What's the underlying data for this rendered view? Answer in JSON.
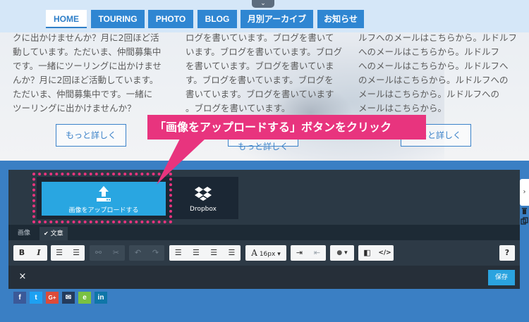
{
  "nav": {
    "toggle_glyph": "⌄",
    "items": [
      "HOME",
      "TOURING",
      "PHOTO",
      "BLOG",
      "月別アーカイブ",
      "お知らせ"
    ]
  },
  "columns": [
    {
      "lines": [
        "クに出かけませんか？月に2回ほど活",
        "動しています。ただいま、仲間募集中",
        "です。一緒にツーリングに出かけませ",
        "んか？月に2回ほど活動しています。",
        "ただいま、仲間募集中です。一緒に",
        "ツーリングに出かけませんか？"
      ],
      "more": "もっと詳しく"
    },
    {
      "lines": [
        "ログを書いています。ブログを書いて",
        "います。ブログを書いています。ブログ",
        "を書いています。ブログを書いていま",
        "す。ブログを書いています。ブログを",
        "書いています。ブログを書いています",
        "。ブログを書いています。"
      ],
      "more": "もっと詳しく"
    },
    {
      "lines": [
        "ルフへのメールはこちらから。ルドルフ",
        "へのメールはこちらから。ルドルフ",
        "へのメールはこちらから。ルドルフへ",
        "のメールはこちらから。ルドルフへの",
        "メールはこちらから。ルドルフへの",
        "メールはこちらから。"
      ],
      "more": "もっと詳しく"
    }
  ],
  "callout": "「画像をアップロードする」ボタンをクリック",
  "editor": {
    "upload_label": "画像をアップロードする",
    "dropbox_label": "Dropbox",
    "tabs": [
      "画像",
      "文章"
    ],
    "tab_check": "✔",
    "font_size": "16px",
    "help": "?",
    "close": "×",
    "save": "保存",
    "side_arrow": "›"
  },
  "toolbar_glyphs": {
    "bold": "B",
    "italic": "I",
    "ol": "☰",
    "ul": "☰",
    "link": "⚯",
    "unlink": "✂",
    "undo": "↶",
    "redo": "↷",
    "align_left": "☰",
    "align_center": "☰",
    "align_right": "☰",
    "justify": "☰",
    "font_a": "A",
    "indent": "⇥",
    "outdent": "⇤",
    "color": "●",
    "caret": "▾",
    "eraser": "◧",
    "code": "</>"
  },
  "social": [
    {
      "label": "f",
      "color": "#3b5998"
    },
    {
      "label": "t",
      "color": "#1da1f2"
    },
    {
      "label": "G+",
      "color": "#dd4b39"
    },
    {
      "label": "✉",
      "color": "#243b5c"
    },
    {
      "label": "e",
      "color": "#7ac142"
    },
    {
      "label": "in",
      "color": "#0e76a8"
    }
  ]
}
